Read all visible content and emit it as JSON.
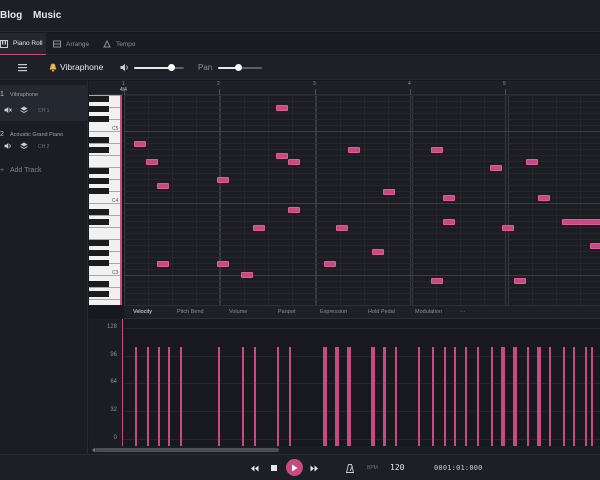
{
  "topbar": {
    "blog": "Blog",
    "music": "Music"
  },
  "tabs": [
    {
      "label": "Piano Roll",
      "active": true
    },
    {
      "label": "Arrange",
      "active": false
    },
    {
      "label": "Tempo",
      "active": false
    }
  ],
  "instrument": {
    "name": "Vibraphone",
    "volume": 0.75,
    "pan_label": "Pan",
    "pan": 0.5
  },
  "tracks": [
    {
      "number": "1",
      "name": "Vibraphone",
      "channel": "CH 1"
    },
    {
      "number": "2",
      "name": "Acoustic Grand Piano",
      "channel": "CH 2"
    }
  ],
  "add_track": "Add Track",
  "ruler": {
    "time_signature": "4/4",
    "bars": [
      "1",
      "2",
      "3",
      "4",
      "5"
    ]
  },
  "keyboard": {
    "octave_labels": [
      "C5",
      "C4",
      "C3"
    ]
  },
  "param_tabs": [
    "Velocity",
    "Pitch Bend",
    "Volume",
    "Panpot",
    "Expression",
    "Hold Pedal",
    "Modulation",
    "···"
  ],
  "velocity_axis": [
    "128",
    "96",
    "64",
    "32",
    "0"
  ],
  "transport": {
    "bpm_label": "BPM",
    "bpm": "120",
    "time": "0001:01:000"
  },
  "colors": {
    "accent": "#c84a82",
    "background": "#17191e"
  }
}
